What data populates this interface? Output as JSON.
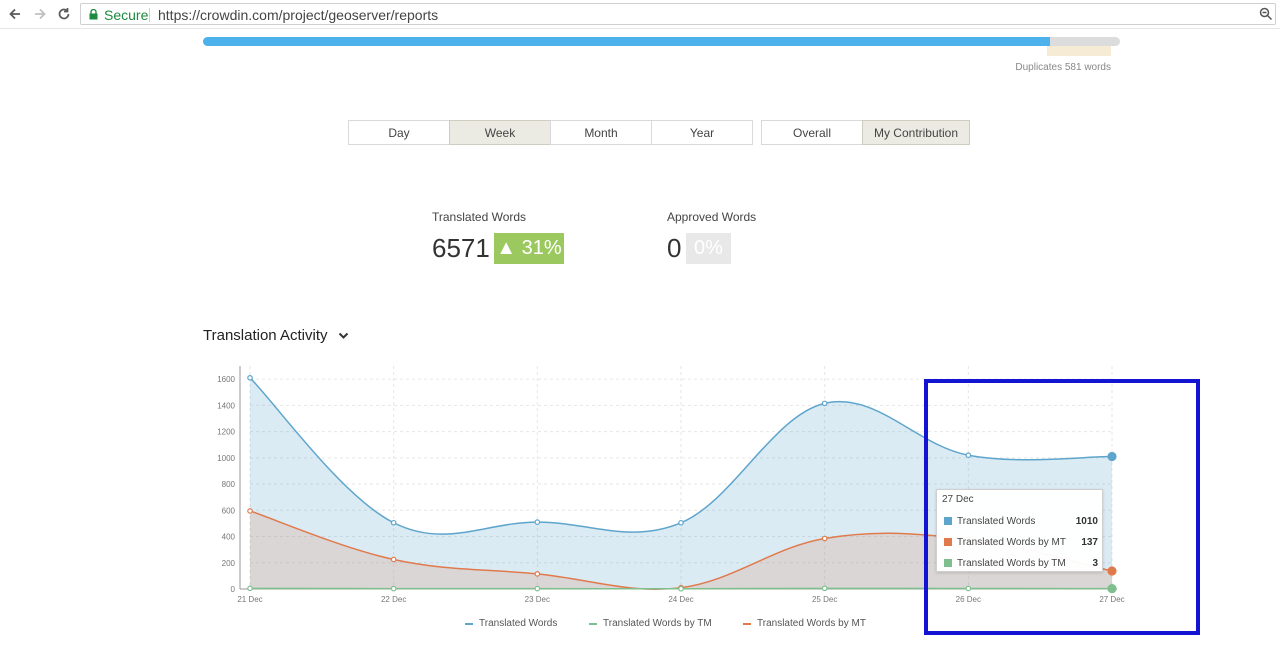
{
  "browser": {
    "secure_label": "Secure",
    "url": "https://crowdin.com/project/geoserver/reports"
  },
  "progress": {
    "fill_percent": 92.4,
    "duplicates_label": "Duplicates 581 words"
  },
  "period_buttons": [
    {
      "label": "Day",
      "active": false
    },
    {
      "label": "Week",
      "active": true
    },
    {
      "label": "Month",
      "active": false
    },
    {
      "label": "Year",
      "active": false
    }
  ],
  "scope_buttons": [
    {
      "label": "Overall",
      "active": false
    },
    {
      "label": "My Contribution",
      "active": true
    }
  ],
  "stats": {
    "translated": {
      "label": "Translated Words",
      "value": "6571",
      "change": "▲ 31%",
      "color": "#9bc95f"
    },
    "approved": {
      "label": "Approved Words",
      "value": "0",
      "change": "0%",
      "color": "#e8e8e8"
    }
  },
  "section": {
    "title": "Translation Activity"
  },
  "chart_data": {
    "type": "area",
    "title": "",
    "xlabel": "",
    "ylabel": "",
    "x": [
      "21 Dec",
      "22 Dec",
      "23 Dec",
      "24 Dec",
      "25 Dec",
      "26 Dec",
      "27 Dec"
    ],
    "yticks": [
      0,
      200,
      400,
      600,
      800,
      1000,
      1200,
      1400,
      1600
    ],
    "ylim": [
      0,
      1700
    ],
    "grid": true,
    "legend_position": "bottom",
    "series": [
      {
        "name": "Translated Words",
        "color": "#5da5cc",
        "values": [
          1610,
          505,
          510,
          505,
          1415,
          1020,
          1010
        ]
      },
      {
        "name": "Translated Words by TM",
        "color": "#7fbf8e",
        "values": [
          5,
          3,
          3,
          2,
          5,
          4,
          3
        ]
      },
      {
        "name": "Translated Words by MT",
        "color": "#e07a4c",
        "values": [
          595,
          225,
          115,
          10,
          385,
          380,
          137
        ]
      }
    ],
    "tooltip": {
      "title": "27 Dec",
      "rows": [
        {
          "name": "Translated Words",
          "value": "1010",
          "color": "#5da5cc"
        },
        {
          "name": "Translated Words by MT",
          "value": "137",
          "color": "#e07a4c"
        },
        {
          "name": "Translated Words by TM",
          "value": "3",
          "color": "#7fbf8e"
        }
      ]
    }
  }
}
